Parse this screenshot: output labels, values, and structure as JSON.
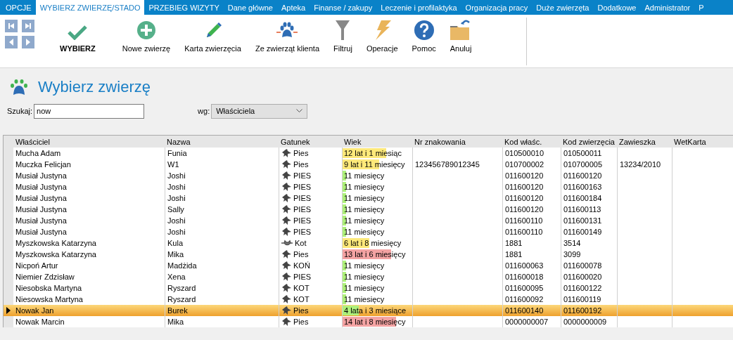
{
  "menu_tabs": [
    {
      "label": "OPCJE",
      "selected": false
    },
    {
      "label": "WYBIERZ ZWIERZĘ/STADO",
      "selected": true
    },
    {
      "label": "PRZEBIEG WIZYTY",
      "selected": false
    },
    {
      "label": "Dane główne",
      "selected": false
    },
    {
      "label": "Apteka",
      "selected": false
    },
    {
      "label": "Finanse / zakupy",
      "selected": false
    },
    {
      "label": "Leczenie i profilaktyka",
      "selected": false
    },
    {
      "label": "Organizacja pracy",
      "selected": false
    },
    {
      "label": "Duże zwierzęta",
      "selected": false
    },
    {
      "label": "Dodatkowe",
      "selected": false
    },
    {
      "label": "Administrator",
      "selected": false
    },
    {
      "label": "P",
      "selected": false
    }
  ],
  "toolbar": {
    "nav_buttons": [
      {
        "kind": "first"
      },
      {
        "kind": "last"
      },
      {
        "kind": "prev"
      },
      {
        "kind": "next"
      }
    ],
    "buttons": [
      {
        "kind": "check",
        "label": "WYBIERZ",
        "default": true
      },
      {
        "kind": "plus",
        "label": "Nowe zwierzę",
        "default": false
      },
      {
        "kind": "pencil",
        "label": "Karta zwierzęcia",
        "default": false
      },
      {
        "kind": "paw",
        "label": "Ze zwierząt klienta",
        "default": false
      },
      {
        "kind": "filter",
        "label": "Filtruj",
        "default": false
      },
      {
        "kind": "bolt",
        "label": "Operacje",
        "default": false
      },
      {
        "kind": "help",
        "label": "Pomoc",
        "default": false
      },
      {
        "kind": "folder",
        "label": "Anuluj",
        "default": false
      }
    ]
  },
  "page_title": "Wybierz zwierzę",
  "search": {
    "label": "Szukaj:",
    "value": "now"
  },
  "search_by": {
    "label": "wg:",
    "value": "Właściciela"
  },
  "table": {
    "columns": [
      "Właściciel",
      "Nazwa",
      "Gatunek",
      "Wiek",
      "Nr znakowania",
      "Kod właśc.",
      "Kod zwierzęcia",
      "Zawieszka",
      "WetKarta"
    ],
    "rows": [
      {
        "owner": "Mucha Adam",
        "name": "Funia",
        "species": {
          "kind": "dog",
          "label": "Pies"
        },
        "age": {
          "text": "12 lat i 1 miesiąc",
          "level": 0.63,
          "color": "#fde97a"
        },
        "chip": "",
        "owner_code": "010500010",
        "animal_code": "010500011",
        "tag": "",
        "wetkarta": "",
        "selected": false
      },
      {
        "owner": "Muczka Felicjan",
        "name": "W1",
        "species": {
          "kind": "dog",
          "label": "Pies"
        },
        "age": {
          "text": "9 lat i 11 miesięcy",
          "level": 0.53,
          "color": "#fde97a"
        },
        "chip": "123456789012345",
        "owner_code": "010700002",
        "animal_code": "010700005",
        "tag": "13234/2010",
        "wetkarta": "",
        "selected": false
      },
      {
        "owner": "Musiał  Justyna",
        "name": "Joshi",
        "species": {
          "kind": "dog",
          "label": "PIES"
        },
        "age": {
          "text": "11 miesięcy",
          "level": 0.05,
          "color": "#aef07a"
        },
        "chip": "",
        "owner_code": "011600120",
        "animal_code": "011600120",
        "tag": "",
        "wetkarta": "",
        "selected": false
      },
      {
        "owner": "Musiał  Justyna",
        "name": "Joshi",
        "species": {
          "kind": "dog",
          "label": "PIES"
        },
        "age": {
          "text": "11 miesięcy",
          "level": 0.05,
          "color": "#aef07a"
        },
        "chip": "",
        "owner_code": "011600120",
        "animal_code": "011600163",
        "tag": "",
        "wetkarta": "",
        "selected": false
      },
      {
        "owner": "Musiał  Justyna",
        "name": "Joshi",
        "species": {
          "kind": "dog",
          "label": "PIES"
        },
        "age": {
          "text": "11 miesięcy",
          "level": 0.05,
          "color": "#aef07a"
        },
        "chip": "",
        "owner_code": "011600120",
        "animal_code": "011600184",
        "tag": "",
        "wetkarta": "",
        "selected": false
      },
      {
        "owner": "Musiał  Justyna",
        "name": "Sally",
        "species": {
          "kind": "dog",
          "label": "PIES"
        },
        "age": {
          "text": "11 miesięcy",
          "level": 0.05,
          "color": "#aef07a"
        },
        "chip": "",
        "owner_code": "011600120",
        "animal_code": "011600113",
        "tag": "",
        "wetkarta": "",
        "selected": false
      },
      {
        "owner": "Musiał Justyna",
        "name": "Joshi",
        "species": {
          "kind": "dog",
          "label": "PIES"
        },
        "age": {
          "text": "11 miesięcy",
          "level": 0.05,
          "color": "#aef07a"
        },
        "chip": "",
        "owner_code": "011600110",
        "animal_code": "011600131",
        "tag": "",
        "wetkarta": "",
        "selected": false
      },
      {
        "owner": "Musiał Justyna",
        "name": "Joshi",
        "species": {
          "kind": "dog",
          "label": "PIES"
        },
        "age": {
          "text": "11 miesięcy",
          "level": 0.05,
          "color": "#aef07a"
        },
        "chip": "",
        "owner_code": "011600110",
        "animal_code": "011600149",
        "tag": "",
        "wetkarta": "",
        "selected": false
      },
      {
        "owner": "Myszkowska Katarzyna",
        "name": "Kula",
        "species": {
          "kind": "cat",
          "label": "Kot"
        },
        "age": {
          "text": "6 lat i 8 miesięcy",
          "level": 0.38,
          "color": "#fde97a"
        },
        "chip": "",
        "owner_code": "1881",
        "animal_code": "3514",
        "tag": "",
        "wetkarta": "",
        "selected": false
      },
      {
        "owner": "Myszkowska Katarzyna",
        "name": "Mika",
        "species": {
          "kind": "dog",
          "label": "Pies"
        },
        "age": {
          "text": "13 lat i 6 miesięcy",
          "level": 0.7,
          "color": "#f4a3a3"
        },
        "chip": "",
        "owner_code": "1881",
        "animal_code": "3099",
        "tag": "",
        "wetkarta": "",
        "selected": false
      },
      {
        "owner": "Nicpoń  Artur",
        "name": "Madżida",
        "species": {
          "kind": "dog",
          "label": "KOŃ"
        },
        "age": {
          "text": "11 miesięcy",
          "level": 0.05,
          "color": "#aef07a"
        },
        "chip": "",
        "owner_code": "011600063",
        "animal_code": "011600078",
        "tag": "",
        "wetkarta": "",
        "selected": false
      },
      {
        "owner": "Niemier  Zdzisław",
        "name": "Xena",
        "species": {
          "kind": "dog",
          "label": "PIES"
        },
        "age": {
          "text": "11 miesięcy",
          "level": 0.05,
          "color": "#aef07a"
        },
        "chip": "",
        "owner_code": "011600018",
        "animal_code": "011600020",
        "tag": "",
        "wetkarta": "",
        "selected": false
      },
      {
        "owner": "Niesobska  Martyna",
        "name": "Ryszard",
        "species": {
          "kind": "dog",
          "label": "KOT"
        },
        "age": {
          "text": "11 miesięcy",
          "level": 0.05,
          "color": "#aef07a"
        },
        "chip": "",
        "owner_code": "011600095",
        "animal_code": "011600122",
        "tag": "",
        "wetkarta": "",
        "selected": false
      },
      {
        "owner": "Niesowska  Martyna",
        "name": "Ryszard",
        "species": {
          "kind": "dog",
          "label": "KOT"
        },
        "age": {
          "text": "11 miesięcy",
          "level": 0.05,
          "color": "#aef07a"
        },
        "chip": "",
        "owner_code": "011600092",
        "animal_code": "011600119",
        "tag": "",
        "wetkarta": "",
        "selected": false
      },
      {
        "owner": "Nowak Jan",
        "name": "Burek",
        "species": {
          "kind": "dog",
          "label": "Pies"
        },
        "age": {
          "text": "4 lata i 3 miesiące",
          "level": 0.23,
          "color": "#aef07a"
        },
        "chip": "",
        "owner_code": "011600140",
        "animal_code": "011600192",
        "tag": "",
        "wetkarta": "",
        "selected": true
      },
      {
        "owner": "Nowak Marcin",
        "name": "Mika",
        "species": {
          "kind": "dog",
          "label": "Pies"
        },
        "age": {
          "text": "14 lat i 8 miesięcy",
          "level": 0.77,
          "color": "#f4a3a3"
        },
        "chip": "",
        "owner_code": "0000000007",
        "animal_code": "0000000009",
        "tag": "",
        "wetkarta": "",
        "selected": false
      }
    ]
  }
}
